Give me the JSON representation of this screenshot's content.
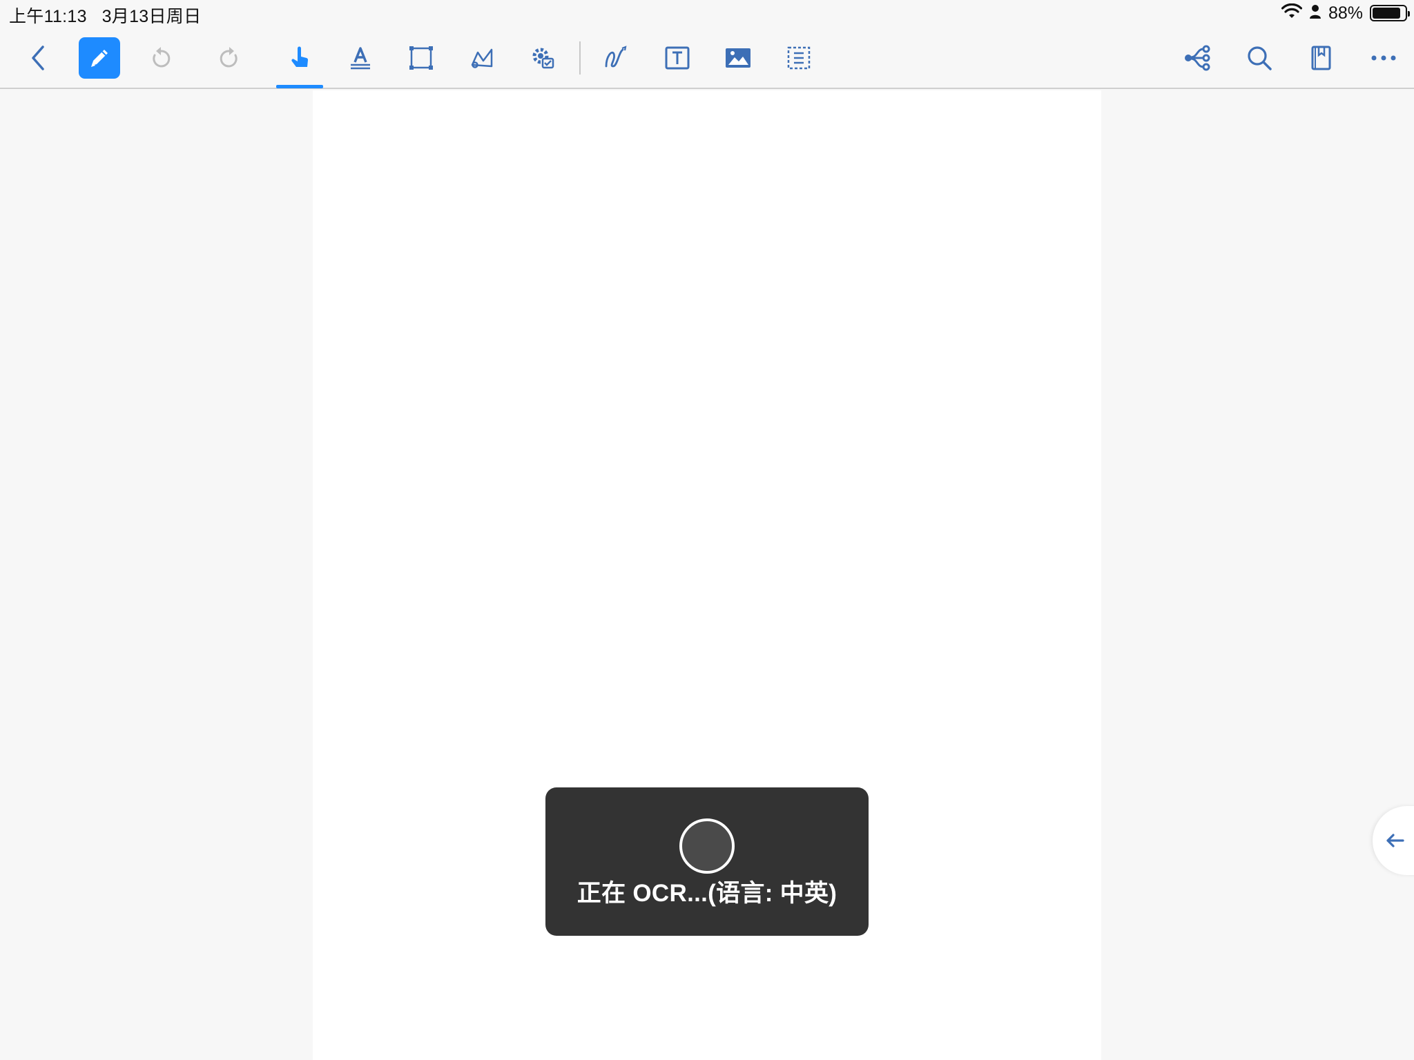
{
  "status_bar": {
    "time": "上午11:13",
    "date": "3月13日周日",
    "battery_pct": "88%",
    "battery_level": 0.88
  },
  "toolbar": {
    "accent_color": "#1e8bff",
    "icon_color": "#3d6fb6",
    "left_icons": [
      "back-chevron-icon",
      "pen-edit-icon",
      "undo-icon",
      "redo-icon",
      "hand-pointer-icon",
      "text-highlight-icon",
      "rect-select-icon",
      "freehand-sign-icon",
      "settings-gear-icon",
      "squiggle-draw-icon",
      "text-box-icon",
      "image-icon",
      "dashed-list-icon"
    ],
    "right_icons": [
      "share-icon",
      "search-icon",
      "bookmark-icon",
      "more-icon"
    ]
  },
  "ocr_toast": {
    "message": "正在 OCR...(语言: 中英)"
  },
  "side_handle": {
    "icon": "arrow-left-icon"
  }
}
